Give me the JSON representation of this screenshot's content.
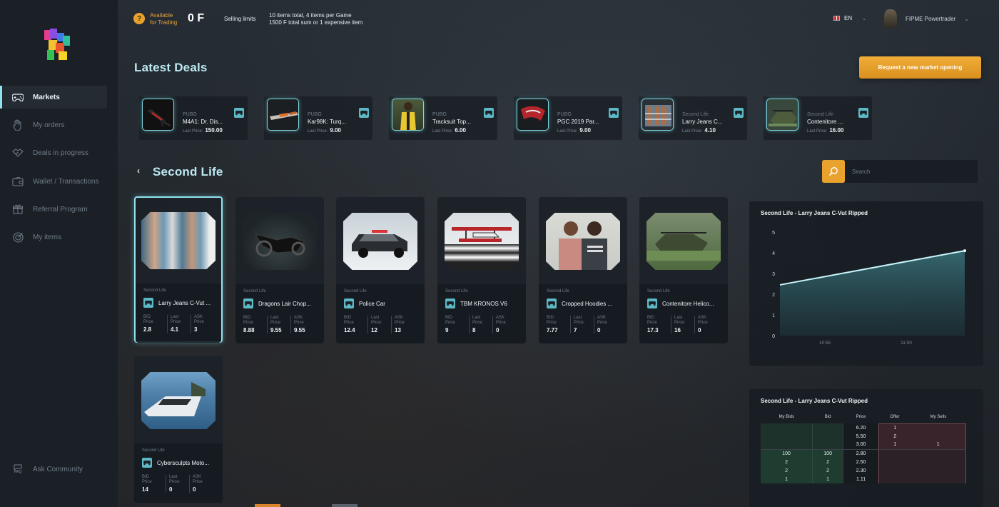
{
  "brand": {
    "logo": "FPME"
  },
  "sidebar": {
    "items": [
      {
        "label": "Markets",
        "icon": "gamepad-icon",
        "active": true
      },
      {
        "label": "My orders",
        "icon": "hand-icon",
        "active": false
      },
      {
        "label": "Deals in progress",
        "icon": "handshake-icon",
        "active": false
      },
      {
        "label": "Wallet / Transactions",
        "icon": "wallet-icon",
        "active": false
      },
      {
        "label": "Referral Program",
        "icon": "gift-icon",
        "active": false
      },
      {
        "label": "My items",
        "icon": "target-icon",
        "active": false
      }
    ],
    "ask_community": "Ask Community",
    "faq_label": "FAQ"
  },
  "header": {
    "available_label": "Available",
    "available_label2": "for Trading",
    "balance": "0 F",
    "limits_label": "Selling limits",
    "limits_line1": "10 items total, 4 items per Game",
    "limits_line2": "1500 F total sum or 1 expensive item",
    "language": "EN",
    "username": "FIPME Powertrader"
  },
  "latest_deals": {
    "title": "Latest Deals",
    "request_button": "Request a new market opening",
    "last_price_label": "Last Price:",
    "items": [
      {
        "game": "PUBG",
        "name": "M4A1: Dr. Dis...",
        "price": "150.00"
      },
      {
        "game": "PUBG",
        "name": "Kar98K: Turq...",
        "price": "9.00"
      },
      {
        "game": "PUBG",
        "name": "Tracksuit Top...",
        "price": "6.00"
      },
      {
        "game": "PUBG",
        "name": "PGC 2019 Par...",
        "price": "9.00"
      },
      {
        "game": "Second Life",
        "name": "Larry Jeans C...",
        "price": "4.10"
      },
      {
        "game": "Second Life",
        "name": "Contenitore ...",
        "price": "16.00"
      }
    ]
  },
  "market": {
    "title": "Second Life",
    "search_placeholder": "Search",
    "labels": {
      "bid1": "BID",
      "bid2": "Price",
      "last1": "Last",
      "last2": "Price:",
      "ask1": "ASK",
      "ask2": "Price"
    },
    "items": [
      {
        "game": "Second Life",
        "name": "Larry Jeans C-Vut ...",
        "bid": "2.8",
        "last": "4.1",
        "ask": "3",
        "selected": true
      },
      {
        "game": "Second Life",
        "name": "Dragons Lair Chop...",
        "bid": "8.88",
        "last": "9.55",
        "ask": "9.55",
        "selected": false
      },
      {
        "game": "Second Life",
        "name": "Police Car",
        "bid": "12.4",
        "last": "12",
        "ask": "13",
        "selected": false
      },
      {
        "game": "Second Life",
        "name": "TBM KRONOS V6",
        "bid": "9",
        "last": "8",
        "ask": "0",
        "selected": false
      },
      {
        "game": "Second Life",
        "name": "Cropped Hoodies ...",
        "bid": "7.77",
        "last": "7",
        "ask": "0",
        "selected": false
      },
      {
        "game": "Second Life",
        "name": "Contenitore Helico...",
        "bid": "17.3",
        "last": "16",
        "ask": "0",
        "selected": false
      },
      {
        "game": "Second Life",
        "name": "Cybersculpts Moto...",
        "bid": "14",
        "last": "0",
        "ask": "0",
        "selected": false
      }
    ]
  },
  "price_chart": {
    "title": "Second Life - Larry Jeans C-Vut Ripped",
    "chart_data": {
      "type": "line",
      "title": "Second Life - Larry Jeans C-Vut Ripped",
      "x": [
        "10:55",
        "11:00"
      ],
      "x_ticks": [
        "10:55",
        "11:00"
      ],
      "ylim": [
        0,
        5
      ],
      "y_ticks": [
        0,
        1,
        2,
        3,
        4,
        5
      ],
      "series": [
        {
          "values": [
            2.45,
            4.1
          ]
        }
      ],
      "grid": false
    }
  },
  "order_book": {
    "title": "Second Life - Larry Jeans C-Vut Ripped",
    "headers": [
      "My Bids",
      "Bid",
      "Price",
      "Offer",
      "My Sells"
    ],
    "rows": [
      [
        "",
        "",
        "6.20",
        "1",
        ""
      ],
      [
        "",
        "",
        "5.50",
        "2",
        ""
      ],
      [
        "",
        "",
        "3.00",
        "1",
        "1"
      ],
      [
        "100",
        "100",
        "2.80",
        "",
        ""
      ],
      [
        "2",
        "2",
        "2.50",
        "",
        ""
      ],
      [
        "2",
        "2",
        "2.30",
        "",
        ""
      ],
      [
        "1",
        "1",
        "1.11",
        "",
        ""
      ]
    ]
  }
}
